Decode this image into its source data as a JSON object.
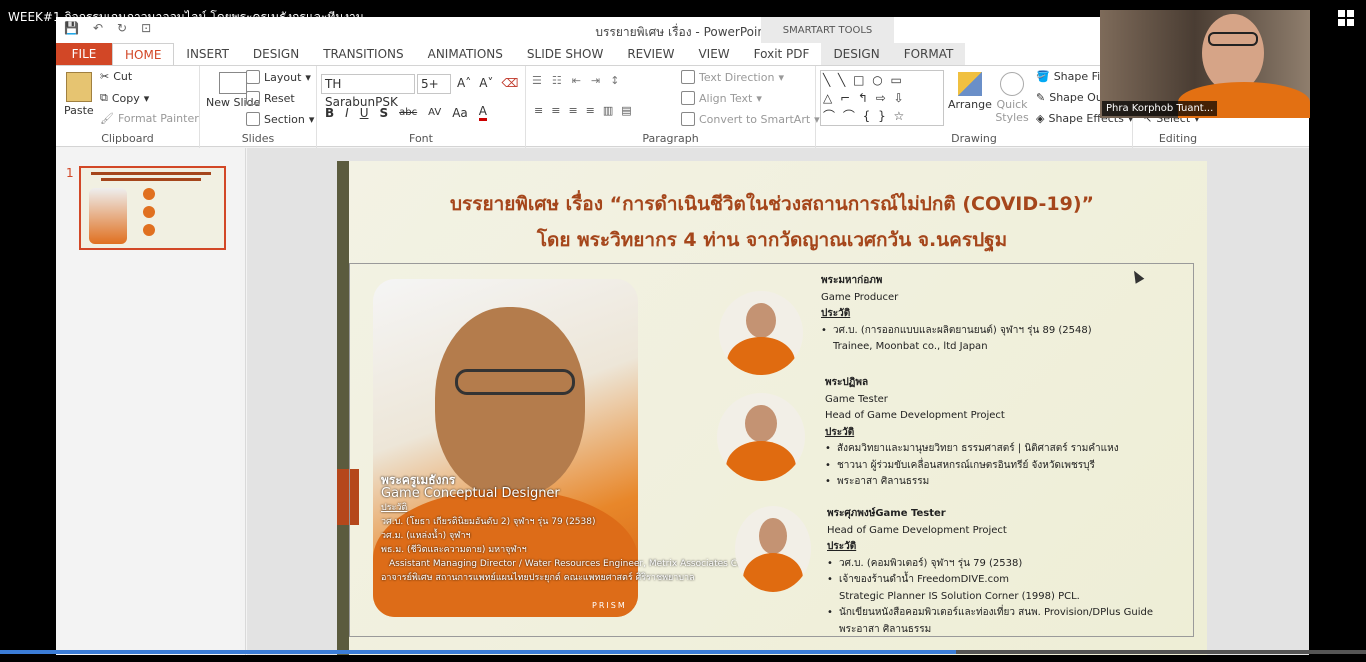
{
  "meeting": {
    "title": "WEEK#1 กิจกรรมเกมภาวนาออนไลน์ โดยพระครูเมธังกรและทีมงาน",
    "participant_name": "Phra Korphob Tuant...",
    "progress": 0.7
  },
  "ppt": {
    "window_title": "บรรยายพิเศษ เรื่อง - PowerPoint",
    "contextual_group": "SMARTART TOOLS",
    "tabs": [
      "FILE",
      "HOME",
      "INSERT",
      "DESIGN",
      "TRANSITIONS",
      "ANIMATIONS",
      "SLIDE SHOW",
      "REVIEW",
      "VIEW",
      "Foxit PDF",
      "DESIGN",
      "FORMAT"
    ],
    "active_tab": "HOME",
    "clipboard": {
      "label": "Clipboard",
      "paste": "Paste",
      "cut": "Cut",
      "copy": "Copy",
      "format_painter": "Format Painter"
    },
    "slides": {
      "label": "Slides",
      "new_slide": "New Slide",
      "layout": "Layout",
      "reset": "Reset",
      "section": "Section"
    },
    "font": {
      "label": "Font",
      "name": "TH SarabunPSK",
      "size": "5+"
    },
    "paragraph": {
      "label": "Paragraph",
      "text_direction": "Text Direction",
      "align_text": "Align Text",
      "convert": "Convert to SmartArt"
    },
    "drawing": {
      "label": "Drawing",
      "arrange": "Arrange",
      "quick_styles": "Quick Styles",
      "shape_fill": "Shape Fill",
      "shape_outline": "Shape Out",
      "shape_effects": "Shape Effects"
    },
    "editing": {
      "label": "Editing",
      "select": "Select"
    }
  },
  "thumbnail": {
    "number": "1"
  },
  "slide": {
    "title_line1": "บรรยายพิเศษ เรื่อง “การดำเนินชีวิตในช่วงสถานการณ์ไม่ปกติ (COVID-19)”",
    "title_line2": "โดย พระวิทยากร 4 ท่าน จากวัดญาณเวศกวัน จ.นครปฐม",
    "main": {
      "name": "พระครูเมธังกร",
      "role": "Game Conceptual Designer",
      "section": "ประวัติ",
      "items": [
        "วศ.บ. (โยธา เกียรตินิยมอันดับ 2) จุฬาฯ รุ่น 79 (2538)",
        "วศ.ม. (แหล่งน้ำ) จุฬาฯ",
        "พธ.ม. (ชีวิตและความตาย) มหาจุฬาฯ",
        "Assistant Managing Director / Water Resources Engineer, Metrix Associates Co., Ltd",
        "อาจารย์พิเศษ สถานการแพทย์แผนไทยประยุกต์ คณะแพทยศาสตร์ ศิริราชพยาบาล"
      ],
      "watermark": "PRISM"
    },
    "p1": {
      "name": "พระมหาก่อภพ",
      "role": "Game Producer",
      "section": "ประวัติ",
      "item1": "วศ.บ. (การออกแบบและผลิตยานยนต์) จุฬาฯ รุ่น 89 (2548)",
      "item1b": "Trainee, Moonbat co., ltd Japan"
    },
    "p2": {
      "name": "พระปฏิพล",
      "role1": "Game Tester",
      "role2": "Head of Game Development Project",
      "section": "ประวัติ",
      "items": [
        "สังคมวิทยาและมานุษยวิทยา ธรรมศาสตร์ | นิติศาสตร์ รามคำแหง",
        "ชาวนา ผู้ร่วมขับเคลื่อนสหกรณ์เกษตรอินทรีย์ จังหวัดเพชรบุรี",
        "พระอาสา ศิลานธรรม"
      ]
    },
    "p3": {
      "name": "พระศุภพงษ์Game Tester",
      "role": "Head of Game Development Project",
      "section": "ประวัติ",
      "item1": "วศ.บ. (คอมพิวเตอร์) จุฬาฯ รุ่น 79 (2538)",
      "item2": "เจ้าของร้านดำน้ำ FreedomDIVE.com",
      "item2b": "Strategic Planner IS Solution Corner (1998) PCL.",
      "item3": "นักเขียนหนังสือคอมพิวเตอร์และท่องเที่ยว สนพ. Provision/DPlus Guide",
      "item3b": "พระอาสา ศิลานธรรม"
    }
  }
}
